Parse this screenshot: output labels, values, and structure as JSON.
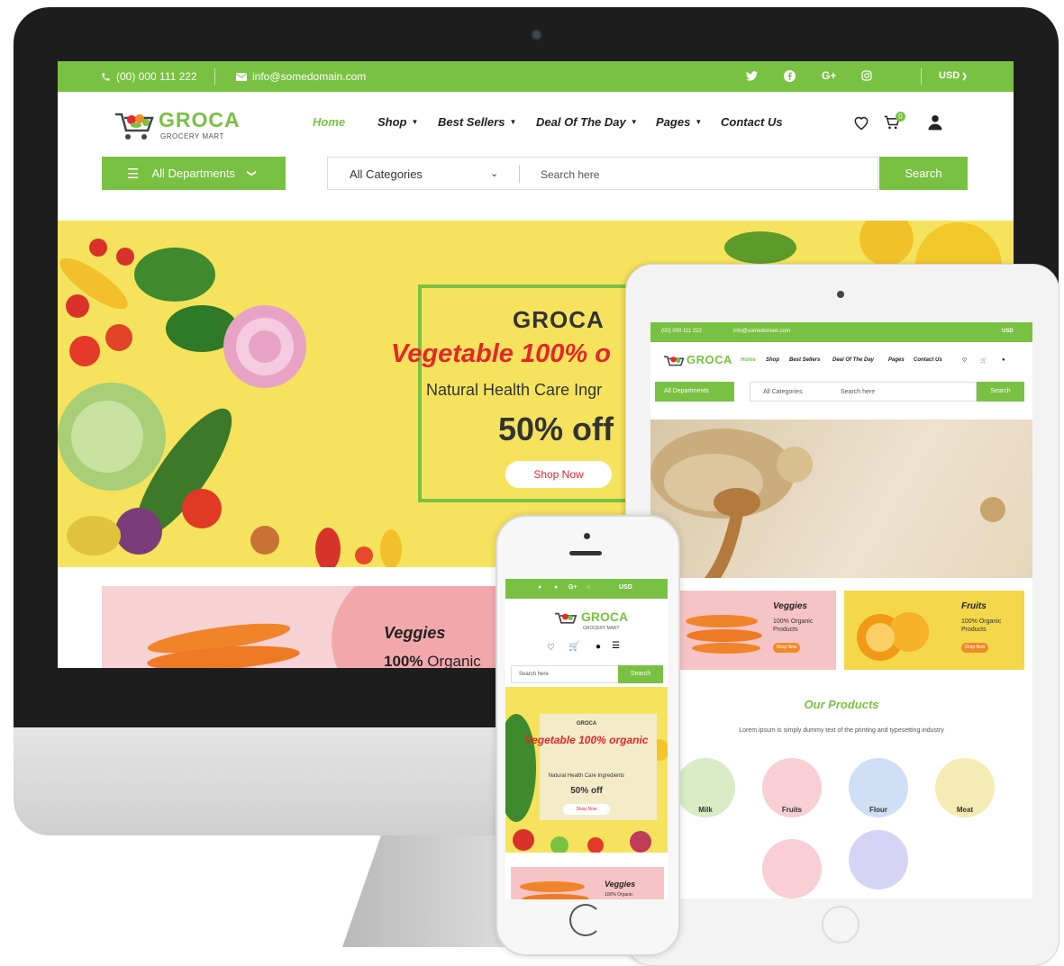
{
  "desktop": {
    "topbar": {
      "phone": "(00) 000 111 222",
      "email": "info@somedomain.com",
      "social": [
        "twitter-icon",
        "facebook-icon",
        "googleplus-icon",
        "instagram-icon"
      ],
      "googleplus_label": "G+",
      "currency": "USD"
    },
    "logo": {
      "name": "GROCA",
      "tagline": "GROCERY MART"
    },
    "nav": [
      {
        "label": "Home",
        "active": true
      },
      {
        "label": "Shop",
        "dropdown": true
      },
      {
        "label": "Best Sellers",
        "dropdown": true
      },
      {
        "label": "Deal Of The Day",
        "dropdown": true
      },
      {
        "label": "Pages",
        "dropdown": true
      },
      {
        "label": "Contact Us"
      }
    ],
    "cart_count": "0",
    "departments_label": "All Departments",
    "category_select": "All Categories",
    "search_placeholder": "Search here",
    "search_button": "Search",
    "hero": {
      "brand": "GROCA",
      "title": "Vegetable 100% o",
      "subtitle": "Natural Health Care Ingr",
      "offer": "50% off",
      "cta": "Shop Now"
    },
    "promo": {
      "title": "Veggies",
      "percent": "100%",
      "text": "Organic"
    }
  },
  "tablet": {
    "topbar": {
      "phone": "(00) 000 111 222",
      "email": "info@somedomain.com",
      "currency": "USD"
    },
    "logo": {
      "name": "GROCA",
      "tagline": "GROCERY MART"
    },
    "nav": [
      "Home",
      "Shop",
      "Best Sellers",
      "Deal Of The Day",
      "Pages",
      "Contact Us"
    ],
    "departments_label": "All Departments",
    "category_select": "All Categories",
    "search_placeholder": "Search here",
    "search_button": "Search",
    "promos": [
      {
        "title": "Veggies",
        "text": "100% Organic Products",
        "cta": "Shop Now"
      },
      {
        "title": "Fruits",
        "text": "100% Organic Products",
        "cta": "Shop Now"
      }
    ],
    "products_heading": "Our Products",
    "products_sub": "Lorem ipsum is simply dummy text of the printing and typesetting industry",
    "categories": [
      "Milk",
      "Fruits",
      "Flour",
      "Meat"
    ]
  },
  "phone": {
    "topbar": {
      "googleplus_label": "G+",
      "currency": "USD"
    },
    "logo": {
      "name": "GROCA",
      "tagline": "GROCERY MART"
    },
    "search_placeholder": "Search here",
    "search_button": "Search",
    "hero": {
      "brand": "GROCA",
      "title": "Vegetable 100% organic",
      "subtitle": "Natural Health Care Ingredients",
      "offer": "50% off",
      "cta": "Shop Now"
    },
    "promo": {
      "title": "Veggies",
      "text": "100% Organic"
    }
  },
  "colors": {
    "brand_green": "#79c142",
    "hero_yellow": "#f6e35d",
    "accent_red": "#e5272a",
    "promo_pink": "#f7d2d4"
  }
}
